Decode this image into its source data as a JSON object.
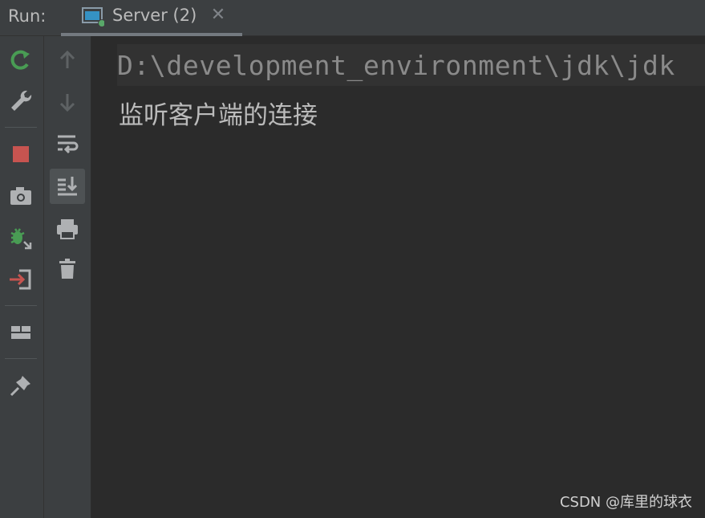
{
  "run_bar": {
    "label": "Run:",
    "tab": {
      "label": "Server (2)",
      "icon": "server-window-icon",
      "close_icon": "close-icon"
    }
  },
  "toolbar_left": [
    {
      "name": "rerun-icon",
      "color": "#499c54"
    },
    {
      "name": "wrench-icon"
    },
    {
      "name": "stop-icon",
      "color": "#c75450"
    },
    {
      "name": "camera-icon"
    },
    {
      "name": "debug-export-icon",
      "color": "#499c54"
    },
    {
      "name": "login-arrow-icon",
      "color": "#c75450"
    },
    {
      "name": "layout-icon"
    },
    {
      "name": "pin-icon"
    }
  ],
  "toolbar_second": [
    {
      "name": "up-arrow-icon"
    },
    {
      "name": "down-arrow-icon"
    },
    {
      "name": "soft-wrap-icon"
    },
    {
      "name": "scroll-to-end-icon",
      "active": true
    },
    {
      "name": "print-icon"
    },
    {
      "name": "trash-icon"
    }
  ],
  "console": {
    "command_line": "D:\\development_environment\\jdk\\jdk",
    "output_line": "监听客户端的连接"
  },
  "watermark": "CSDN @库里的球衣",
  "colors": {
    "background": "#2b2b2b",
    "toolbar": "#3c3f41",
    "text": "#bbbbbb",
    "green": "#499c54",
    "red": "#c75450"
  }
}
